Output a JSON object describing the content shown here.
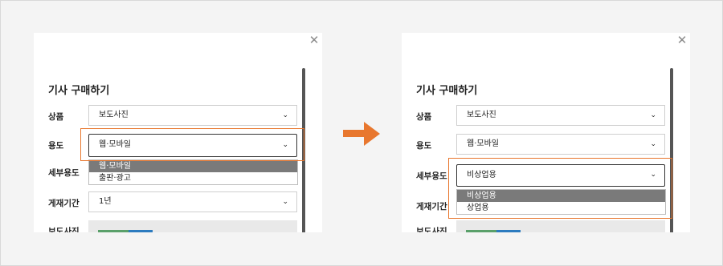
{
  "colors": {
    "highlight": "#e8772e",
    "arrow": "#e8772e",
    "selected_option_bg": "#7a7a7a"
  },
  "left_panel": {
    "title": "기사 구매하기",
    "close_icon": "close-icon",
    "fields": {
      "product_label": "상품",
      "product_value": "보도사진",
      "usage_label": "용도",
      "usage_value": "웹·모바일",
      "detail_usage_label": "세부용도",
      "period_label": "게재기간",
      "period_value": "1년",
      "photo_label": "보도사진"
    },
    "usage_options": [
      "웹·모바일",
      "출판·광고"
    ]
  },
  "right_panel": {
    "title": "기사 구매하기",
    "close_icon": "close-icon",
    "fields": {
      "product_label": "상품",
      "product_value": "보도사진",
      "usage_label": "용도",
      "usage_value": "웹·모바일",
      "detail_usage_label": "세부용도",
      "detail_usage_value": "비상업용",
      "period_label": "게재기간",
      "photo_label": "보도사진"
    },
    "detail_usage_options": [
      "비상업용",
      "상업용"
    ]
  },
  "arrow_icon": "right-arrow-icon"
}
